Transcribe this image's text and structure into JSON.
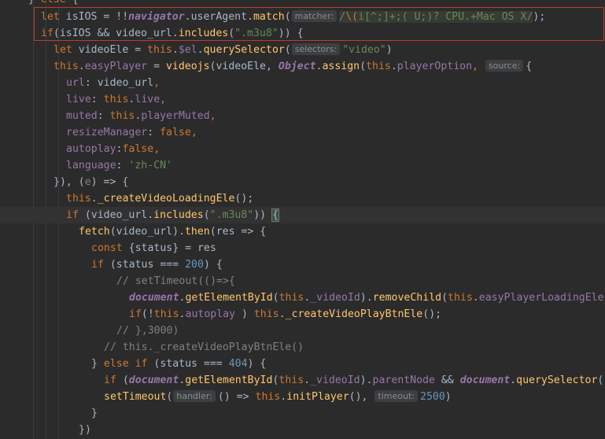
{
  "editor": {
    "language": "javascript",
    "inlay_hints": {
      "matcher": "matcher:",
      "selectors": "selectors:",
      "source": "source:",
      "handler": "handler:",
      "timeout": "timeout:"
    },
    "colors": {
      "background": "#2b2b2b",
      "keyword": "#cc7832",
      "function": "#ffc66d",
      "string": "#6a8759",
      "number": "#6897bb",
      "property": "#9876aa",
      "comment": "#808080",
      "selection_border": "#c0392b"
    }
  },
  "code": {
    "l0": {
      "a": "} ",
      "b": "else",
      "c": " {"
    },
    "l1": {
      "a": "let",
      "b": " isIOS = !!",
      "c": "navigator",
      "d": ".userAgent.",
      "e": "match",
      "f": "(",
      "g": "/",
      "h": "\\(",
      "i": "i[^;]+;( U;)? CPU.+Mac OS X",
      "j": "/",
      "k": ");"
    },
    "l2": {
      "a": "if",
      "b": "(isIOS && video_url.",
      "c": "includes",
      "d": "(",
      "e": "\".m3u8\"",
      "f": ")) {"
    },
    "l3": {
      "a": "let",
      "b": " videoEle = ",
      "c": "this",
      "d": ".",
      "e": "$el",
      "f": ".",
      "g": "querySelector",
      "h": "(",
      "i": "\"video\"",
      "j": ")"
    },
    "l4": {
      "a": "this",
      "b": ".",
      "c": "easyPlayer",
      "d": " = ",
      "e": "videojs",
      "f": "(videoEle, ",
      "g": "Object",
      "h": ".",
      "i": "assign",
      "j": "(",
      "k": "this",
      "l": ".",
      "m": "playerOption",
      "n": ", ",
      "o": "{"
    },
    "l5": {
      "a": "url",
      "b": ": video_url",
      "c": ","
    },
    "l6": {
      "a": "live",
      "b": ": ",
      "c": "this",
      "d": ".",
      "e": "live",
      "f": ","
    },
    "l7": {
      "a": "muted",
      "b": ": ",
      "c": "this",
      "d": ".",
      "e": "playerMuted",
      "f": ","
    },
    "l8": {
      "a": "resizeManager",
      "b": ": ",
      "c": "false",
      "d": ","
    },
    "l9": {
      "a": "autoplay",
      "b": ":",
      "c": "false",
      "d": ","
    },
    "l10": {
      "a": "language",
      "b": ": ",
      "c": "'zh-CN'"
    },
    "l11": {
      "a": "}), (",
      "b": "e",
      "c": ") => {"
    },
    "l12": {
      "a": "this",
      "b": ".",
      "c": "_createVideoLoadingEle",
      "d": "();"
    },
    "l13": {
      "a": "if",
      "b": " (video_url.",
      "c": "includes",
      "d": "(",
      "e": "\".m3u8\"",
      "f": ")) ",
      "g": "{"
    },
    "l14": {
      "a": "fetch",
      "b": "(video_url).",
      "c": "then",
      "d": "(res => {"
    },
    "l15": {
      "a": "const",
      "b": " {status} = res"
    },
    "l16": {
      "a": "if",
      "b": " (status === ",
      "c": "200",
      "d": ") {"
    },
    "l17": {
      "a": "// setTimeout(()=>{"
    },
    "l18": {
      "a": "document",
      "b": ".",
      "c": "getElementById",
      "d": "(",
      "e": "this",
      "f": ".",
      "g": "_videoId",
      "h": ").",
      "i": "removeChild",
      "j": "(",
      "k": "this",
      "l": ".",
      "m": "easyPlayerLoadingEle"
    },
    "l19": {
      "a": "if",
      "b": "(!",
      "c": "this",
      "d": ".",
      "e": "autoplay",
      "f": " ) ",
      "g": "this",
      "h": ".",
      "i": "_createVideoPlayBtnEle",
      "j": "();"
    },
    "l20": {
      "a": "// },3000)"
    },
    "l21": {
      "a": "// this._createVideoPlayBtnEle()"
    },
    "l22": {
      "a": "} ",
      "b": "else if",
      "c": " (status === ",
      "d": "404",
      "e": ") {"
    },
    "l23": {
      "a": "if",
      "b": " (",
      "c": "document",
      "d": ".",
      "e": "getElementById",
      "f": "(",
      "g": "this",
      "h": ".",
      "i": "_videoId",
      "j": ").",
      "k": "parentNode",
      "l": " && ",
      "m": "document",
      "n": ".",
      "o": "querySelector",
      "p": "("
    },
    "l24": {
      "a": "setTimeout",
      "b": "(",
      "c": "() => ",
      "d": "this",
      "e": ".",
      "f": "initPlayer",
      "g": "(), ",
      "h": "2500",
      "i": ")"
    },
    "l25": {
      "a": "}"
    },
    "l26": {
      "a": "})"
    }
  }
}
